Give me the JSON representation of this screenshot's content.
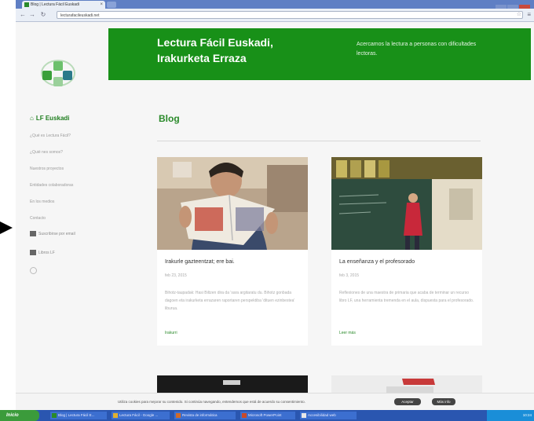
{
  "browser": {
    "tab_title": "Blog | Lectura Fácil Euskadi",
    "url": "lecturafacileuskadi.net"
  },
  "site": {
    "title_line1": "Lectura Fácil Euskadi,",
    "title_line2": "Irakurketa Erraza",
    "tagline": "Acercamos la lectura a personas con dificultades lectoras.",
    "brand": "LF Euskadi",
    "accent": "#189018"
  },
  "sidebar": {
    "items": [
      {
        "label": "¿Qué es Lectura Fácil?"
      },
      {
        "label": "¿Quié nes somos?"
      },
      {
        "label": "Nuestros proyectos"
      },
      {
        "label": "Entidades colaboradoras"
      },
      {
        "label": "En los medios"
      },
      {
        "label": "Contacto"
      }
    ],
    "subscribe": "Suscribirse por email",
    "library": "Libros LF"
  },
  "main": {
    "heading": "Blog"
  },
  "posts": [
    {
      "title": "Irakurle gazteentzat; ere bai.",
      "date": "feb 23, 2015",
      "excerpt": "Bihotz-taupadak: Hasi Biltzen dira da 'sara argitaratu du. Bihotz gonbada dagoen eta irakurketa errazaren raportaren perspektiba 'dituen ezinbestea' liburua.",
      "read_more": "Irakurri"
    },
    {
      "title": "La enseñanza y el profesorado",
      "date": "feb 3, 2015",
      "excerpt": "Reflexiones de una maestra de primaria que acaba de terminar un recurso libro LF, una herramienta tremenda en el aula, dispuesta para el profesorado.",
      "read_more": "Leer más"
    }
  ],
  "cookie": {
    "text": "Utiliza cookies para mejorar su contenido. Si continúa navegando, entendemos que está de acuerdo su consentimiento.",
    "accept": "Aceptar",
    "more": "Más info"
  },
  "taskbar": {
    "start": "Inicio",
    "tasks": [
      "Blog | Lectura Fácil E...",
      "Lectura Fácil - Google ...",
      "Revista de informática",
      "Microsoft PowerPoint",
      "Accesibilidad web"
    ],
    "clock": "10:24"
  }
}
